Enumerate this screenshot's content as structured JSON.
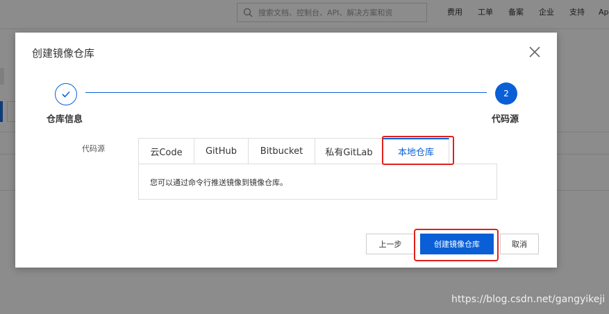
{
  "topbar": {
    "search_placeholder": "搜索文档、控制台、API、解决方案和资",
    "nav_items": [
      "费用",
      "工单",
      "备案",
      "企业",
      "支持",
      "Ap"
    ]
  },
  "dialog": {
    "title": "创建镜像仓库",
    "steps": [
      {
        "label": "仓库信息",
        "status": "done"
      },
      {
        "label": "代码源",
        "number": "2",
        "status": "current"
      }
    ],
    "field_label": "代码源",
    "tabs": [
      "云Code",
      "GitHub",
      "Bitbucket",
      "私有GitLab",
      "本地仓库"
    ],
    "active_tab_index": 4,
    "panel_text": "您可以通过命令行推送镜像到镜像仓库。",
    "buttons": {
      "prev": "上一步",
      "create": "创建镜像仓库",
      "cancel": "取消"
    }
  },
  "colors": {
    "primary": "#0a5fd6",
    "highlight": "#e0201c"
  },
  "watermark": "https://blog.csdn.net/gangyikeji"
}
